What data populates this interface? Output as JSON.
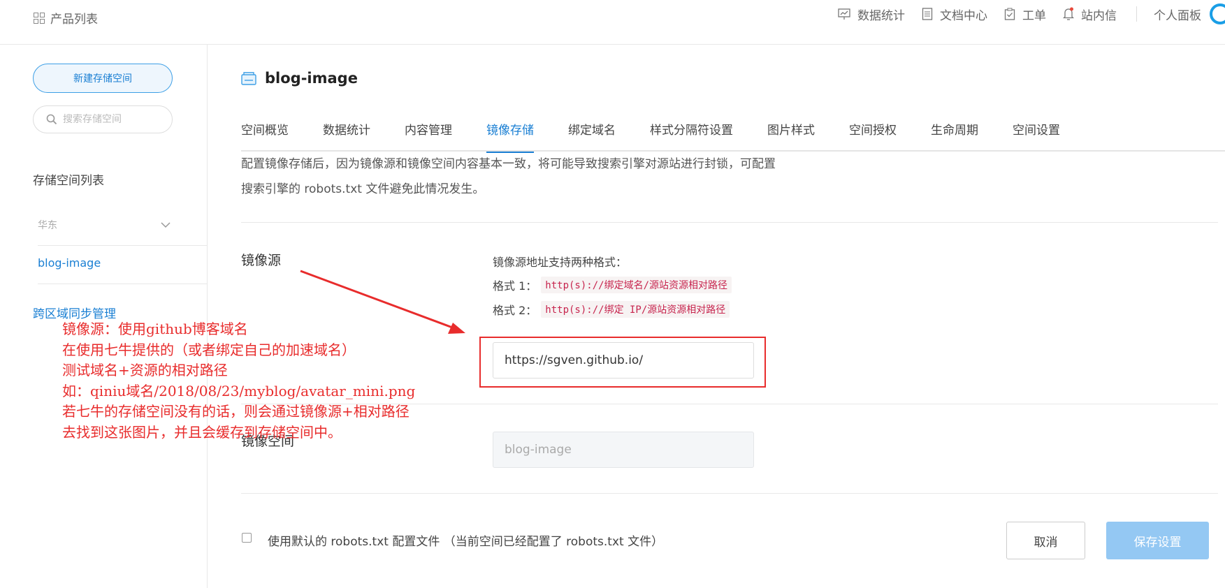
{
  "topbar": {
    "product_list": "产品列表",
    "nav": [
      {
        "icon": "chart-icon",
        "label": "数据统计"
      },
      {
        "icon": "document-icon",
        "label": "文档中心"
      },
      {
        "icon": "clipboard-icon",
        "label": "工单"
      },
      {
        "icon": "bell-icon",
        "label": "站内信"
      }
    ],
    "personal": "个人面板"
  },
  "sidebar": {
    "new_bucket": "新建存储空间",
    "search_placeholder": "搜索存储空间",
    "list_title": "存储空间列表",
    "region": "华东",
    "bucket": "blog-image",
    "cors_sync": "跨区域同步管理"
  },
  "main": {
    "bucket_title": "blog-image",
    "tabs": [
      {
        "label": "空间概览"
      },
      {
        "label": "数据统计"
      },
      {
        "label": "内容管理"
      },
      {
        "label": "镜像存储",
        "active": true
      },
      {
        "label": "绑定域名"
      },
      {
        "label": "样式分隔符设置"
      },
      {
        "label": "图片样式"
      },
      {
        "label": "空间授权"
      },
      {
        "label": "生命周期"
      },
      {
        "label": "空间设置"
      }
    ],
    "desc_line1": "配置镜像存储后，因为镜像源和镜像空间内容基本一致，将可能导致搜索引擎对源站进行封锁，可配置",
    "desc_line2": "搜索引擎的 robots.txt 文件避免此情况发生。",
    "mirror_source_label": "镜像源",
    "format_head": "镜像源地址支持两种格式：",
    "format1_label": "格式 1：",
    "format1_code": "http(s)://绑定域名/源站资源相对路径",
    "format2_label": "格式 2：",
    "format2_code": "http(s)://绑定 IP/源站资源相对路径",
    "mirror_source_value": "https://sgven.github.io/",
    "mirror_space_label": "镜像空间",
    "mirror_space_value": "blog-image",
    "robots_checkbox": "使用默认的 robots.txt 配置文件 （当前空间已经配置了 robots.txt 文件）",
    "cancel": "取消",
    "save": "保存设置"
  },
  "annotation": {
    "color": "#e82c2c",
    "lines": [
      "镜像源：使用github博客域名",
      "在使用七牛提供的（或者绑定自己的加速域名）",
      "测试域名+资源的相对路径",
      "如：qiniu域名/2018/08/23/myblog/avatar_mini.png",
      "若七牛的存储空间没有的话，则会通过镜像源+相对路径",
      "去找到这张图片，并且会缓存到存储空间中。"
    ]
  },
  "colors": {
    "accent": "#1a7fd3",
    "save_button": "#94c8f3",
    "annotation": "#e82c2c"
  }
}
